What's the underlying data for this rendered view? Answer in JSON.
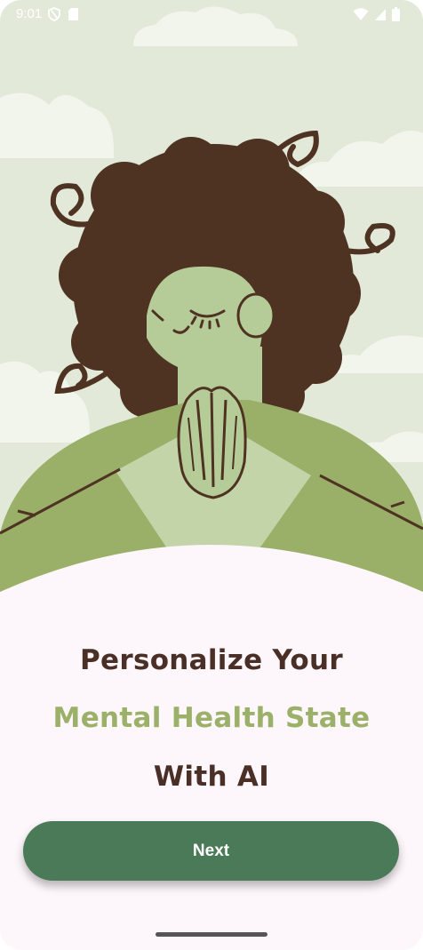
{
  "status_bar": {
    "time": "9:01",
    "left_icons": [
      "vpn-shield-icon",
      "sim-card-icon"
    ],
    "right_icons": [
      "wifi-icon",
      "signal-icon",
      "battery-icon"
    ]
  },
  "illustration": {
    "subject": "meditation-illustration",
    "colors": {
      "sky": "#e2e9d9",
      "cloud": "#f1f5ec",
      "hair": "#4e3222",
      "skin": "#b6cc98",
      "sweater": "#9aaf68",
      "sweater_light": "#c4d4a9"
    }
  },
  "onboarding": {
    "title_line_1": "Personalize Your",
    "title_line_2": "Mental Health State",
    "title_line_3": "With AI",
    "next_button": "Next"
  },
  "colors": {
    "background": "#fdf6fa",
    "title_dark": "#4a2f27",
    "title_accent": "#9bb068",
    "button": "#4a7a58"
  }
}
